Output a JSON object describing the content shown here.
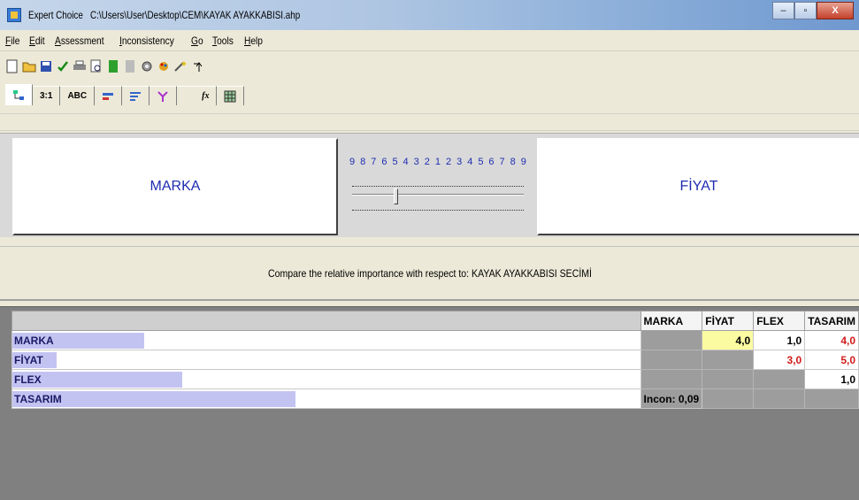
{
  "window": {
    "app_name": "Expert Choice",
    "file_path": "C:\\Users\\User\\Desktop\\CEM\\KAYAK AYAKKABISI.ahp",
    "min_glyph": "–",
    "max_glyph": "▫",
    "close_glyph": "X"
  },
  "menu": [
    "File",
    "Edit",
    "Assessment",
    "Inconsistency",
    "Go",
    "Tools",
    "Help"
  ],
  "toolbar_icons": [
    "new-file-icon",
    "open-folder-icon",
    "save-icon",
    "check-icon",
    "print-icon",
    "print-preview-icon",
    "green-book-icon",
    "gray-book-icon",
    "gear-icon",
    "paint-icon",
    "wand-icon",
    "arrow-up-icon"
  ],
  "tabs": [
    {
      "label": "",
      "icon": "tree-icon"
    },
    {
      "label": "3:1"
    },
    {
      "label": "ABC"
    },
    {
      "label": "",
      "icon": "bars-icon"
    },
    {
      "label": "",
      "icon": "lines-icon"
    },
    {
      "label": "",
      "icon": "fork-icon"
    },
    {
      "label": "fx"
    },
    {
      "label": "",
      "icon": "grid-icon"
    }
  ],
  "compare": {
    "left": "MARKA",
    "right": "FİYAT",
    "scale": [
      "9",
      "8",
      "7",
      "6",
      "5",
      "4",
      "3",
      "2",
      "1",
      "2",
      "3",
      "4",
      "5",
      "6",
      "7",
      "8",
      "9"
    ],
    "slider_value": -4.0
  },
  "question": "Compare the relative importance with respect to: KAYAK AYAKKABISI SECİMİ",
  "matrix": {
    "columns": [
      "MARKA",
      "FİYAT",
      "FLEX",
      "TASARIM"
    ],
    "rows": [
      {
        "name": "MARKA",
        "bar": 0.21,
        "cells": [
          "",
          "4,0",
          "1,0",
          "4,0"
        ],
        "styles": [
          "gray",
          "yellow",
          "",
          "red"
        ]
      },
      {
        "name": "FİYAT",
        "bar": 0.07,
        "cells": [
          "",
          "",
          "3,0",
          "5,0"
        ],
        "styles": [
          "gray",
          "gray",
          "red",
          "red"
        ]
      },
      {
        "name": "FLEX",
        "bar": 0.27,
        "cells": [
          "",
          "",
          "",
          "1,0"
        ],
        "styles": [
          "gray",
          "gray",
          "gray",
          ""
        ]
      },
      {
        "name": "TASARIM",
        "bar": 0.45,
        "cells": [
          "Incon: 0,09",
          "",
          "",
          ""
        ],
        "styles": [
          "incon",
          "gray",
          "gray",
          "gray"
        ]
      }
    ]
  },
  "colors": {
    "node_text": "#1e2db0",
    "bar": "#c3c3f2",
    "highlight": "#fbfba2",
    "inverted_value": "#d21a1a"
  }
}
